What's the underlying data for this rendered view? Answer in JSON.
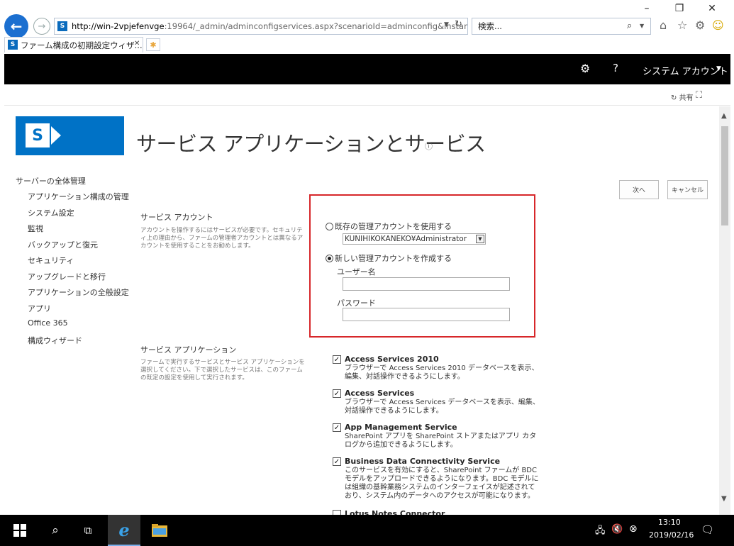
{
  "browser": {
    "url_host": "http://win-2vpjefenvge",
    "url_rest": ":19964/_admin/adminconfigservices.aspx?scenarioId=adminconfig&instanc",
    "search_placeholder": "検索...",
    "tab_title": "ファーム構成の初期設定ウィザ...",
    "win_minimize": "–",
    "win_restore": "❐",
    "win_close": "✕"
  },
  "suitebar": {
    "account": "システム アカウント"
  },
  "ribbon": {
    "share": "共有"
  },
  "page": {
    "title": "サービス アプリケーションとサービス",
    "next_button": "次へ",
    "cancel_button": "キャンセル"
  },
  "leftnav": {
    "top": "サーバーの全体管理",
    "items": [
      "アプリケーション構成の管理",
      "システム設定",
      "監視",
      "バックアップと復元",
      "セキュリティ",
      "アップグレードと移行",
      "アプリケーションの全般設定",
      "アプリ",
      "Office 365",
      "構成ウィザード"
    ]
  },
  "service_account": {
    "title": "サービス アカウント",
    "description": "アカウントを操作するにはサービスが必要です。セキュリティ上の理由から、ファームの管理者アカウントとは異なるアカウントを使用することをお勧めします。",
    "existing_label": "既存の管理アカウントを使用する",
    "existing_value": "KUNIHIKOKANEKO¥Administrator",
    "new_label": "新しい管理アカウントを作成する",
    "username_label": "ユーザー名",
    "password_label": "パスワード",
    "username_value": "",
    "password_value": ""
  },
  "service_apps": {
    "title": "サービス アプリケーション",
    "description": "ファームで実行するサービスとサービス アプリケーションを選択してください。下で選択したサービスは、このファームの既定の設定を使用して実行されます。",
    "items": [
      {
        "name": "Access Services 2010",
        "desc": "ブラウザーで Access Services 2010 データベースを表示、編集、対話操作できるようにします。",
        "checked": true
      },
      {
        "name": "Access Services",
        "desc": "ブラウザーで Access Services データベースを表示、編集、対話操作できるようにします。",
        "checked": true
      },
      {
        "name": "App Management Service",
        "desc": "SharePoint アプリを SharePoint ストアまたはアプリ カタログから追加できるようにします。",
        "checked": true
      },
      {
        "name": "Business Data Connectivity Service",
        "desc": "このサービスを有効にすると、SharePoint ファームが BDC モデルをアップロードできるようになります。BDC モデルには組織の基幹業務システムのインターフェイスが記述されており、システム内のデータへのアクセスが可能になります。",
        "checked": true
      },
      {
        "name": "Lotus Notes Connector",
        "desc": "",
        "checked": false
      }
    ]
  },
  "taskbar": {
    "time": "13:10",
    "date": "2019/02/16"
  }
}
